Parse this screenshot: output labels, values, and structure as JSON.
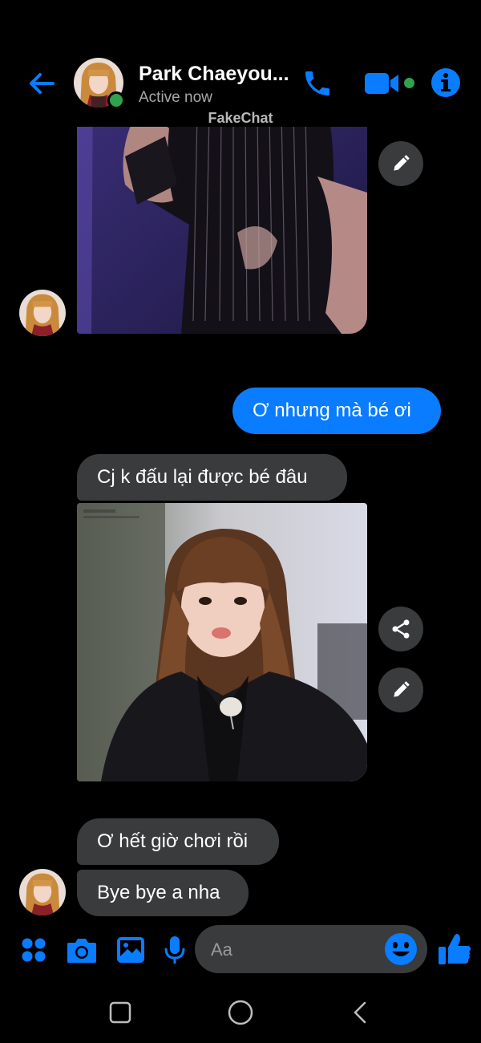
{
  "header": {
    "contact_name": "Park Chaeyou...",
    "status": "Active now",
    "watermark": "FakeChat"
  },
  "messages": [
    {
      "type": "image",
      "from": "contact",
      "description": "photo-black-fringe-outfit"
    },
    {
      "type": "text",
      "from": "me",
      "text": "Ơ nhưng mà bé ơi"
    },
    {
      "type": "text",
      "from": "contact",
      "text": "Cj k đấu lại được bé đâu"
    },
    {
      "type": "image",
      "from": "contact",
      "description": "photo-girl-bangs-black-jacket"
    },
    {
      "type": "text",
      "from": "contact",
      "text": "Ơ hết giờ chơi rồi"
    },
    {
      "type": "text",
      "from": "contact",
      "text": "Bye bye a nha"
    }
  ],
  "composer": {
    "placeholder": "Aa"
  },
  "colors": {
    "accent": "#0a7cff",
    "background": "#000000",
    "received_bubble": "#3a3b3c",
    "online": "#31a24c"
  },
  "icons": {
    "header": [
      "back-arrow-icon",
      "phone-icon",
      "video-camera-icon",
      "info-icon"
    ],
    "composer": [
      "apps-grid-icon",
      "camera-icon",
      "image-gallery-icon",
      "microphone-icon",
      "emoji-icon",
      "thumbs-up-icon"
    ],
    "nav": [
      "recent-apps-icon",
      "home-icon",
      "back-icon"
    ]
  }
}
